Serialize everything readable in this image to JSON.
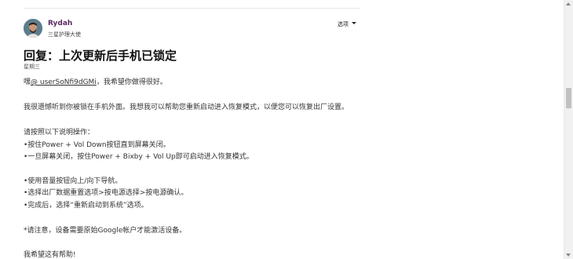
{
  "author": {
    "name": "Rydah",
    "rank": "三星护理大使",
    "avatar_icon": "user-avatar"
  },
  "options": {
    "label": "选项",
    "icon": "chevron-down-icon"
  },
  "post": {
    "title": "回复：上次更新后手机已锁定",
    "date": "星期三",
    "greeting_prefix": "嘿",
    "mention": "@ userSoNfi9dGMi",
    "greeting_suffix": "，我希望你做得很好。",
    "line_1": "我很遗憾听到你被锁在手机外面。我想我可以帮助您重新启动进入恢复模式，以便您可以恢复出厂设置。",
    "line_2": "请按照以下说明操作：",
    "line_3": "•按住Power + Vol Down按钮直到屏幕关闭。",
    "line_4": "•一旦屏幕关闭，按住Power + Bixby + Vol Up即可启动进入恢复模式。",
    "line_5": "•使用音量按钮向上/向下导航。",
    "line_6": "•选择出厂数据重置选项>按电源选择>按电源确认。",
    "line_7": "•完成后，选择“重新启动到系统”选项。",
    "line_8": "*请注意，设备需要原始Google帐户才能激活设备。",
    "line_9": "我希望这有帮助!"
  },
  "colors": {
    "author_name": "#5a2a62",
    "text": "#333333",
    "title": "#111111"
  }
}
